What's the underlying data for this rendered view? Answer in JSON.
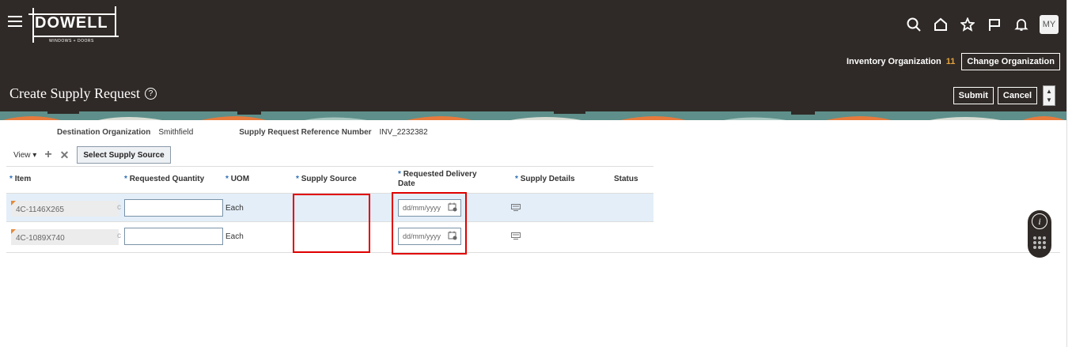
{
  "header": {
    "brand": "DOWELL",
    "brand_sub": "WINDOWS + DOORS",
    "user_initials": "MY",
    "org_label": "Inventory Organization",
    "org_value": "11",
    "change_org_label": "Change Organization"
  },
  "page": {
    "title": "Create Supply Request",
    "submit_label": "Submit",
    "cancel_label": "Cancel"
  },
  "info": {
    "dest_org_label": "Destination Organization",
    "dest_org_value": "Smithfield",
    "ref_label": "Supply Request Reference Number",
    "ref_value": "INV_2232382"
  },
  "toolbar": {
    "view_label": "View",
    "select_source_label": "Select Supply Source"
  },
  "table": {
    "columns": {
      "item": "Item",
      "qty": "Requested Quantity",
      "uom": "UOM",
      "source": "Supply Source",
      "date_line1": "Requested Delivery",
      "date_line2": "Date",
      "details": "Supply Details",
      "status": "Status"
    },
    "rows": [
      {
        "item": "4C-1146X265",
        "uom": "Each",
        "date_placeholder": "dd/mm/yyyy"
      },
      {
        "item": "4C-1089X740",
        "uom": "Each",
        "date_placeholder": "dd/mm/yyyy"
      }
    ]
  },
  "colors": {
    "header_bg": "#2f2a27",
    "selected_row": "#e3eef9",
    "highlight": "#e00000",
    "required": "#2b6fb6"
  }
}
